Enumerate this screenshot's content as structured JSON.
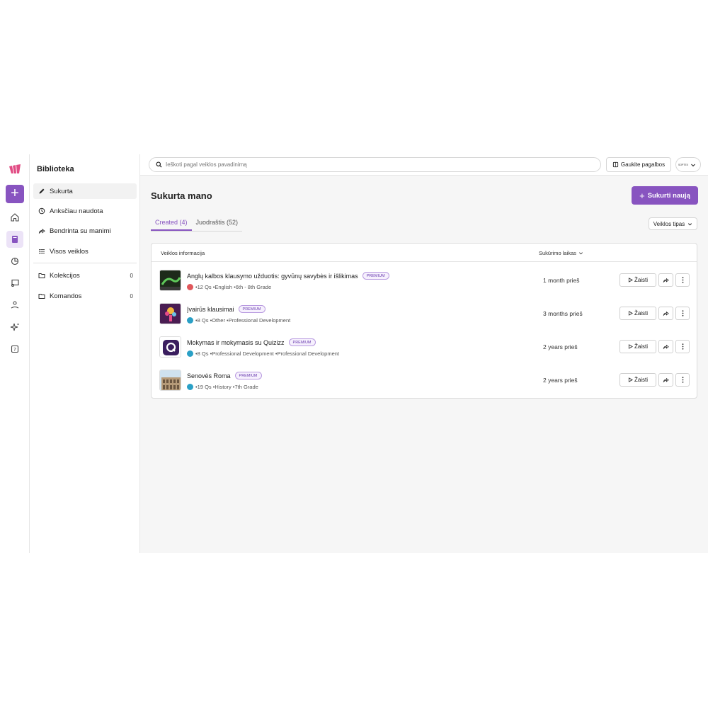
{
  "sidebar": {
    "title": "Biblioteka",
    "items": [
      {
        "label": "Sukurta",
        "icon": "pencil-icon"
      },
      {
        "label": "Anksčiau naudota",
        "icon": "clock-icon"
      },
      {
        "label": "Bendrinta su manimi",
        "icon": "share-icon"
      },
      {
        "label": "Visos veiklos",
        "icon": "list-icon"
      }
    ],
    "groups": [
      {
        "label": "Kolekcijos",
        "count": "0",
        "icon": "folder-icon"
      },
      {
        "label": "Komandos",
        "count": "0",
        "icon": "folder-icon"
      }
    ]
  },
  "rail": {
    "icons": [
      "logo-icon",
      "plus-icon",
      "home-icon",
      "library-icon",
      "reports-icon",
      "classes-icon",
      "accommodations-icon",
      "ai-sparkle-icon",
      "help-icon"
    ]
  },
  "topbar": {
    "search_placeholder": "Ieškoti pagal veiklos pavadinimą",
    "help_label": "Gaukite pagalbos",
    "avatar_text": "SOPTEX"
  },
  "main": {
    "title": "Sukurta mano",
    "new_button": "Sukurti naują",
    "tabs": [
      {
        "label": "Created (4)",
        "active": true
      },
      {
        "label": "Juodraštis (52)",
        "active": false
      }
    ],
    "type_filter": "Veiklos tipas",
    "table": {
      "col_info": "Veiklos informacija",
      "col_time": "Sukūrimo laikas",
      "play_label": "Žaisti",
      "rows": [
        {
          "title": "Anglų kalbos klausymo užduotis: gyvūnų savybės ir išlikimas",
          "badge": "PREMIUM",
          "questions": "12 Qs",
          "meta": [
            "English",
            "6th - 8th Grade"
          ],
          "time": "1 month prieš",
          "icon_color": "#e0575b"
        },
        {
          "title": "Įvairūs klausimai",
          "badge": "PREMIUM",
          "questions": "8 Qs",
          "meta": [
            "Other",
            "Professional Development"
          ],
          "time": "3 months prieš",
          "icon_color": "#2aa0c6"
        },
        {
          "title": "Mokymas ir mokymasis su Quizizz",
          "badge": "PREMIUM",
          "questions": "8 Qs",
          "meta": [
            "Professional Development",
            "Professional Development"
          ],
          "time": "2 years prieš",
          "icon_color": "#2aa0c6"
        },
        {
          "title": "Senovės Roma",
          "badge": "PREMIUM",
          "questions": "19 Qs",
          "meta": [
            "History",
            "7th Grade"
          ],
          "time": "2 years prieš",
          "icon_color": "#2aa0c6"
        }
      ]
    }
  },
  "colors": {
    "accent": "#8854c0",
    "accent_light": "#ece3f7",
    "background": "#f6f6f6"
  }
}
